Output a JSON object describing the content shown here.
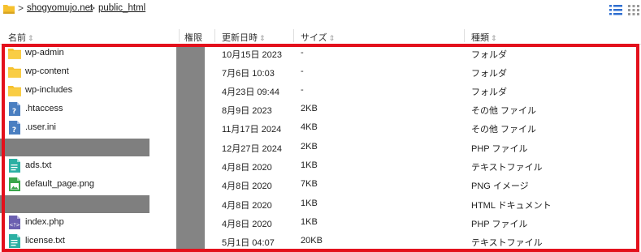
{
  "breadcrumb": {
    "home_icon": "folder-home-icon",
    "items": [
      "shogyomujo.net",
      "public_html"
    ],
    "separator": ">"
  },
  "toolbar": {
    "list_view_icon": "list-view-icon",
    "grid_view_icon": "grid-view-icon"
  },
  "columns": {
    "name": "名前",
    "permission": "権限",
    "modified": "更新日時",
    "size": "サイズ",
    "type": "種類",
    "sort_indicator": "⇕"
  },
  "rows": [
    {
      "name": "wp-admin",
      "icon": "folder-icon",
      "modified": "10月15日 2023",
      "size": "-",
      "type": "フォルダ"
    },
    {
      "name": "wp-content",
      "icon": "folder-icon",
      "modified": "7月6日 10:03",
      "size": "-",
      "type": "フォルダ"
    },
    {
      "name": "wp-includes",
      "icon": "folder-icon",
      "modified": "4月23日 09:44",
      "size": "-",
      "type": "フォルダ"
    },
    {
      "name": ".htaccess",
      "icon": "unknown-file-icon",
      "modified": "8月9日 2023",
      "size": "2KB",
      "type": "その他 ファイル"
    },
    {
      "name": ".user.ini",
      "icon": "unknown-file-icon",
      "modified": "11月17日 2024",
      "size": "4KB",
      "type": "その他 ファイル"
    },
    {
      "name": "",
      "icon": "",
      "modified": "12月27日 2024",
      "size": "2KB",
      "type": "PHP ファイル"
    },
    {
      "name": "ads.txt",
      "icon": "text-file-icon",
      "modified": "4月8日 2020",
      "size": "1KB",
      "type": "テキストファイル"
    },
    {
      "name": "default_page.png",
      "icon": "image-file-icon",
      "modified": "4月8日 2020",
      "size": "7KB",
      "type": "PNG イメージ"
    },
    {
      "name": "",
      "icon": "",
      "modified": "4月8日 2020",
      "size": "1KB",
      "type": "HTML ドキュメント"
    },
    {
      "name": "index.php",
      "icon": "php-file-icon",
      "modified": "4月8日 2020",
      "size": "1KB",
      "type": "PHP ファイル"
    },
    {
      "name": "license.txt",
      "icon": "text-file-icon",
      "modified": "5月1日 04:07",
      "size": "20KB",
      "type": "テキストファイル"
    }
  ],
  "colors": {
    "highlight_frame": "#e3101c",
    "redaction": "#808080",
    "folder": "#f6c12e",
    "unknown_file": "#4a7fc1",
    "text_file": "#2bb0a3",
    "image_file": "#3aa64b",
    "php_file": "#6b5fb0"
  }
}
